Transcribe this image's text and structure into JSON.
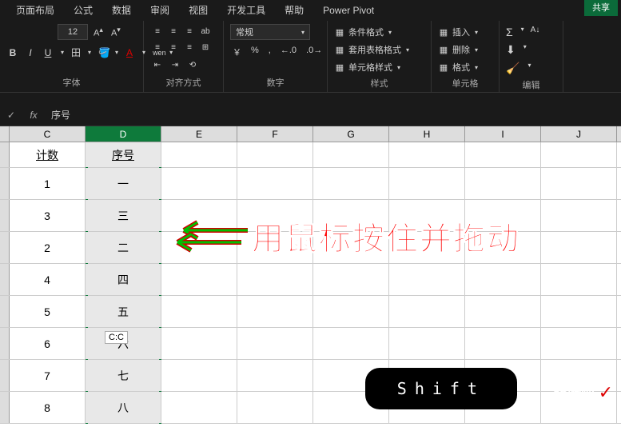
{
  "tabs": {
    "layout": "页面布局",
    "formula": "公式",
    "data": "数据",
    "review": "审阅",
    "view": "视图",
    "dev": "开发工具",
    "help": "帮助",
    "pivot": "Power Pivot",
    "share": "共享"
  },
  "font": {
    "size": "12",
    "inc": "A↑",
    "dec": "A↓",
    "bold": "B",
    "italic": "I",
    "underline": "U",
    "border": "田",
    "fill": "◇",
    "color": "A",
    "wen": "wen",
    "group_label": "字体"
  },
  "align": {
    "group_label": "对齐方式",
    "wrap": "ab"
  },
  "number": {
    "format": "常规",
    "currency": "￥",
    "percent": "%",
    "comma": ",",
    "inc_dec": "°0",
    "dec_dec": ".00",
    "group_label": "数字"
  },
  "styles": {
    "conditional": "条件格式",
    "table": "套用表格格式",
    "cell": "单元格样式",
    "group_label": "样式"
  },
  "cells": {
    "insert": "插入",
    "delete": "删除",
    "format": "格式",
    "group_label": "单元格"
  },
  "edit": {
    "sum": "Σ",
    "sort": "A↓Z",
    "fill": "⬇",
    "clear": "◇",
    "group_label": "编辑"
  },
  "formula_bar": {
    "cancel": "✓",
    "fx": "fx",
    "value": "序号"
  },
  "columns": {
    "c": "C",
    "d": "D",
    "e": "E",
    "f": "F",
    "g": "G",
    "h": "H",
    "i": "I",
    "j": "J"
  },
  "headers": {
    "count": "计数",
    "seq": "序号"
  },
  "rows": [
    {
      "c": "1",
      "d": "一"
    },
    {
      "c": "3",
      "d": "三"
    },
    {
      "c": "2",
      "d": "二"
    },
    {
      "c": "4",
      "d": "四"
    },
    {
      "c": "5",
      "d": "五"
    },
    {
      "c": "6",
      "d": "六"
    },
    {
      "c": "7",
      "d": "七"
    },
    {
      "c": "8",
      "d": "八"
    }
  ],
  "drag_tip": "C:C",
  "annotation": "用鼠标按住并拖动",
  "shift_key": "Shift",
  "watermark": {
    "line1": "经验啦",
    "check": "✓",
    "line2": "jingyanla.com"
  }
}
